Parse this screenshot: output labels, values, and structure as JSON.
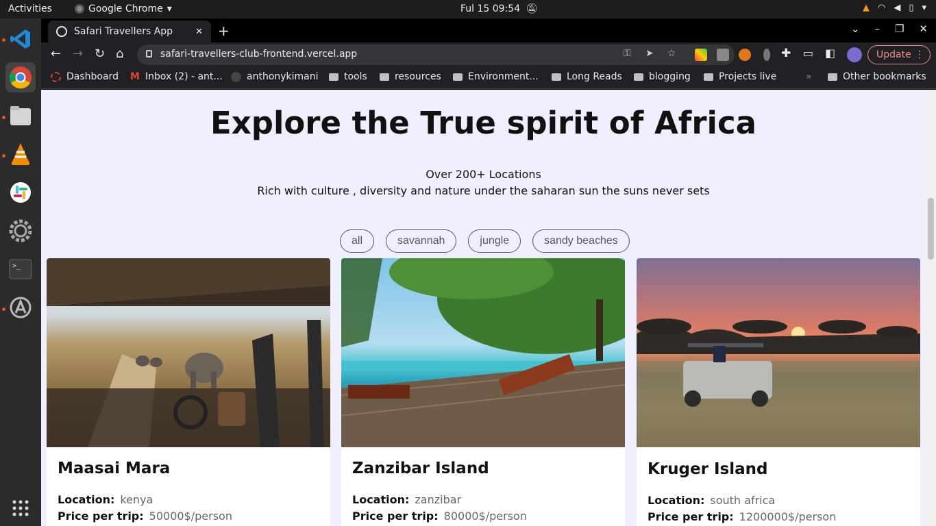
{
  "topbar": {
    "activities": "Activities",
    "app": "Google Chrome",
    "clock": "Ful 15  09:54"
  },
  "dock": {
    "items": [
      "vscode-icon",
      "chrome-icon",
      "files-icon",
      "vlc-icon",
      "slack-icon",
      "settings-icon",
      "terminal-icon",
      "software-icon"
    ]
  },
  "browser": {
    "tab_title": "Safari Travellers App",
    "url": "safari-travellers-club-frontend.vercel.app",
    "update_label": "Update",
    "bookmarks": [
      "Dashboard",
      "Inbox (2) - ant...",
      "anthonykimani",
      "tools",
      "resources",
      "Environment...",
      "Long Reads",
      "blogging",
      "Projects live",
      "Other bookmarks"
    ],
    "overflow": "»"
  },
  "page": {
    "heading": "Explore the True spirit of Africa",
    "sub1": "Over 200+ Locations",
    "sub2": "Rich with culture , diversity and nature under the saharan sun the suns never sets",
    "filters": [
      "all",
      "savannah",
      "jungle",
      "sandy beaches"
    ],
    "cards": [
      {
        "title": "Maasai Mara",
        "location_label": "Location:",
        "location": "kenya",
        "price_label": "Price per trip:",
        "price": "50000$/person"
      },
      {
        "title": "Zanzibar Island",
        "location_label": "Location:",
        "location": "zanzibar",
        "price_label": "Price per trip:",
        "price": "80000$/person"
      },
      {
        "title": "Kruger Island",
        "location_label": "Location:",
        "location": "south africa",
        "price_label": "Price per trip:",
        "price": "1200000$/person"
      }
    ]
  }
}
